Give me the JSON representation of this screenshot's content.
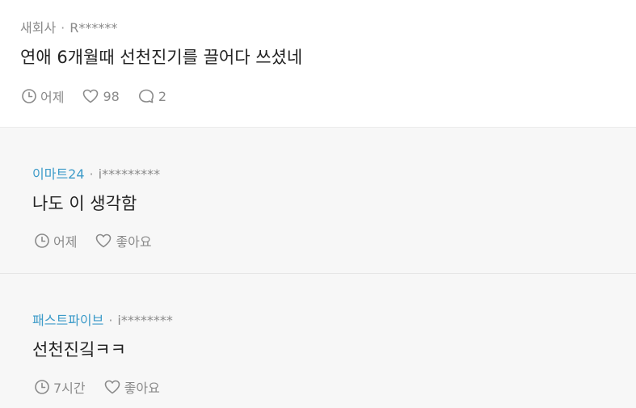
{
  "post": {
    "company": "새회사",
    "separator": "·",
    "author": "R******",
    "content": "연애 6개월때 선천진기를 끌어다 쓰셨네",
    "time": "어제",
    "likes": "98",
    "comments": "2"
  },
  "replies": [
    {
      "company": "이마트24",
      "separator": "·",
      "author": "i*********",
      "content": "나도 이 생각함",
      "time": "어제",
      "like_label": "좋아요"
    },
    {
      "company": "패스트파이브",
      "separator": "·",
      "author": "i********",
      "content": "선천진깈ㅋㅋ",
      "time": "7시간",
      "like_label": "좋아요"
    }
  ],
  "colors": {
    "company_link": "#3d9bc9",
    "muted_text": "#8a8a8a",
    "reply_background": "#f7f7f7"
  }
}
